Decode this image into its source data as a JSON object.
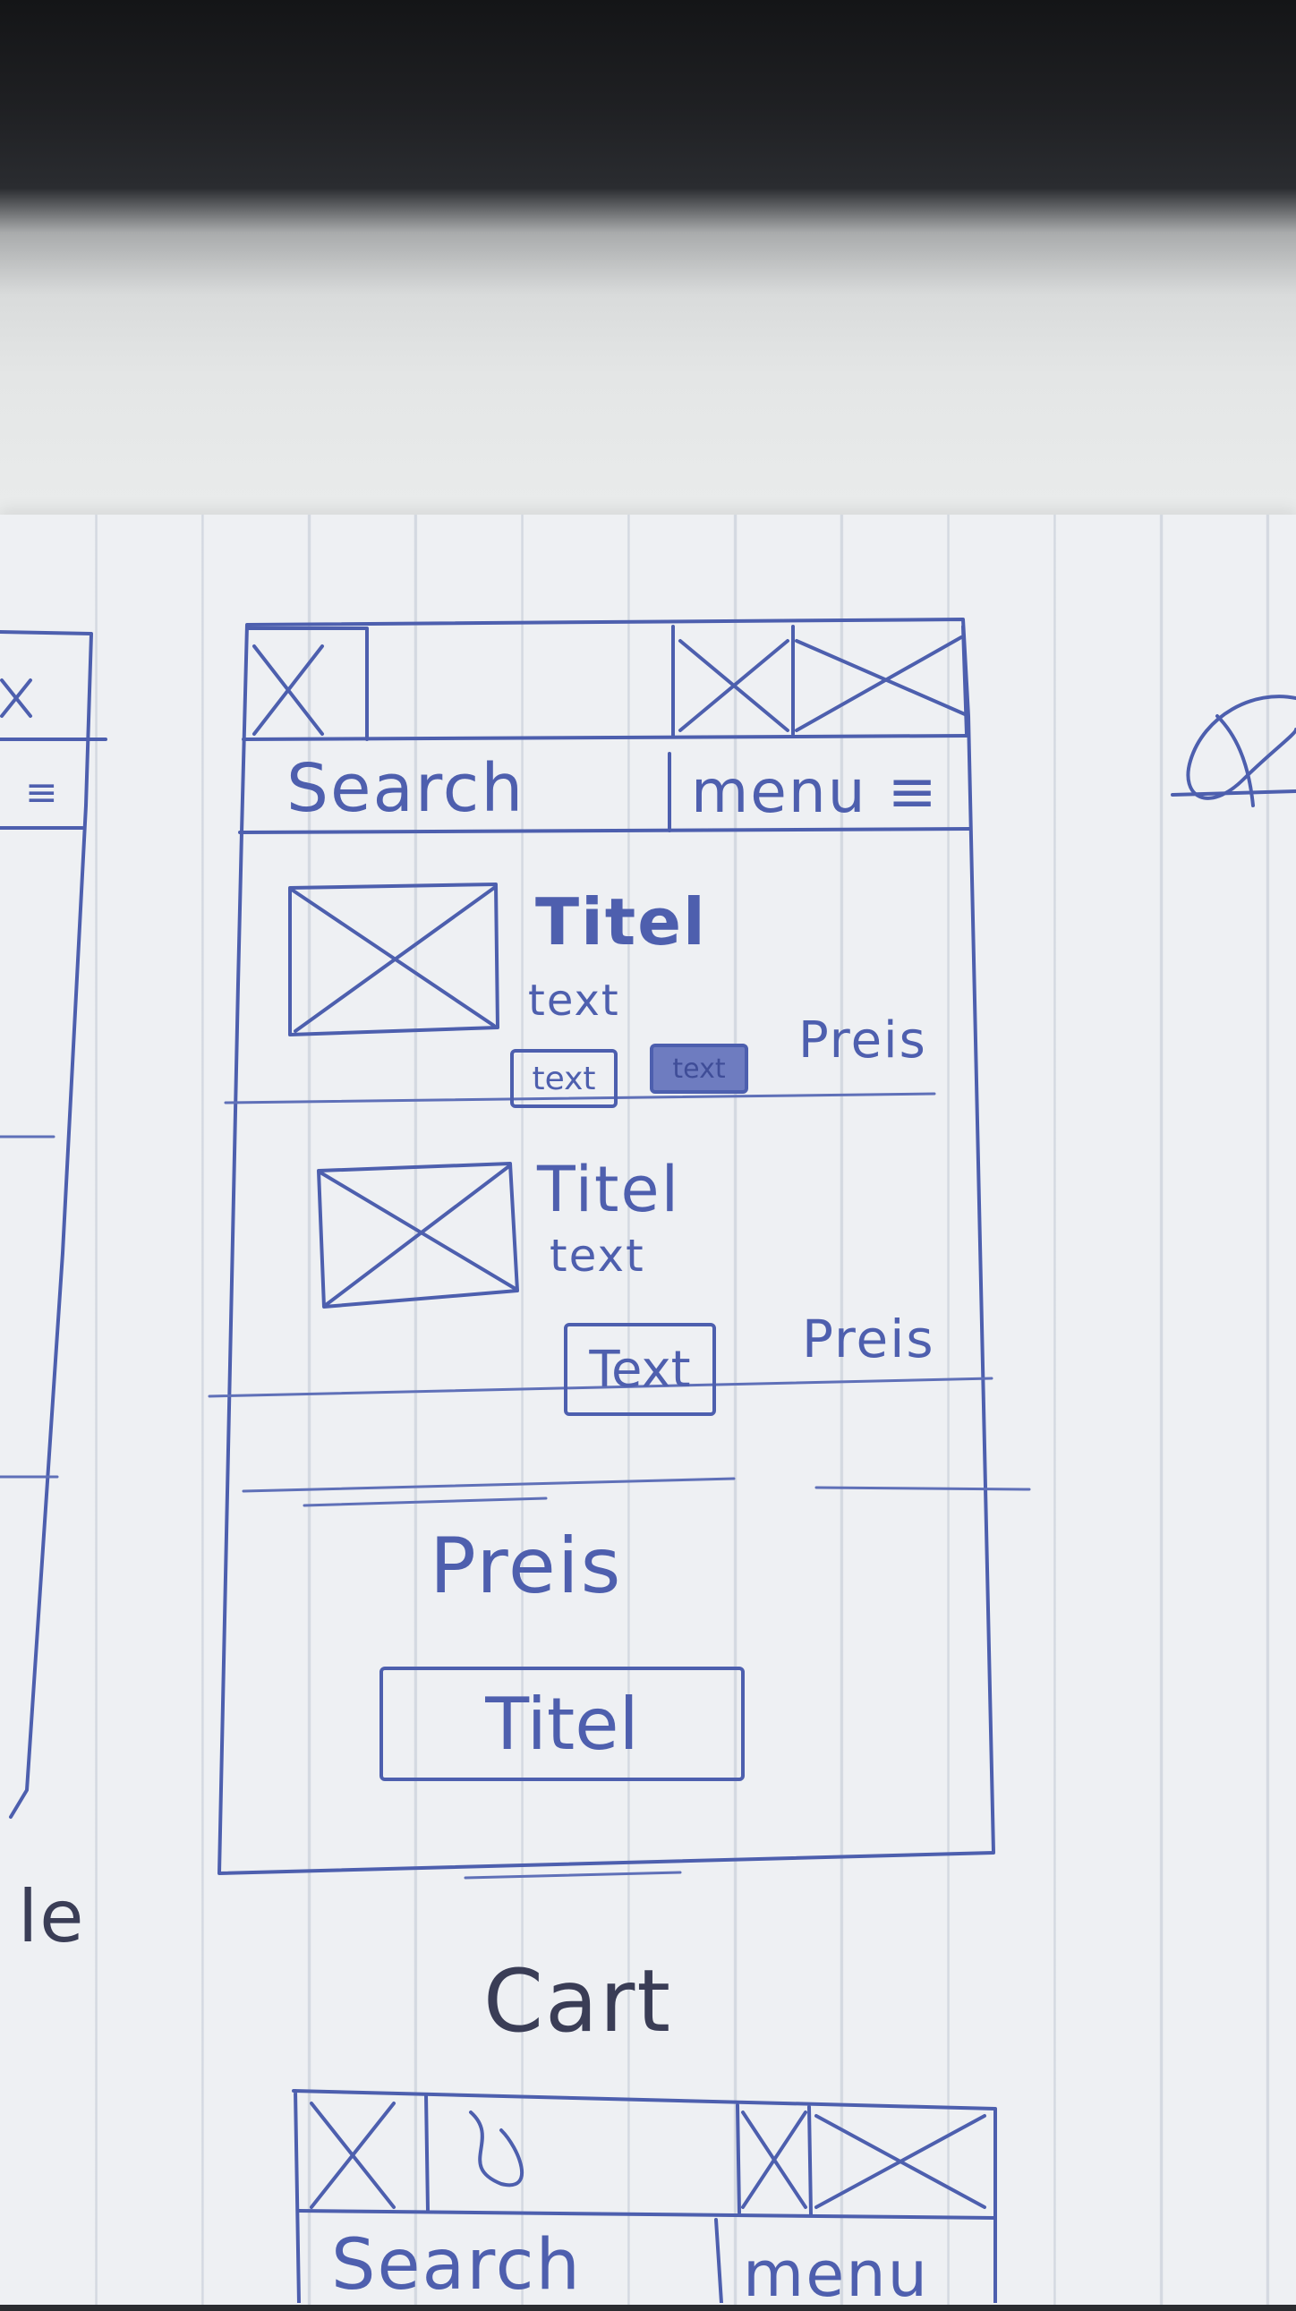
{
  "main_sketch": {
    "header": {
      "search_label": "Search",
      "menu_label": "menu ≡"
    },
    "products": [
      {
        "title": "Titel",
        "description": "text",
        "tags": [
          "text",
          "text"
        ],
        "price": "Preis"
      },
      {
        "title": "Titel",
        "description": "text",
        "tags": [
          "Text"
        ],
        "price": "Preis"
      }
    ],
    "summary": {
      "price": "Preis",
      "button_label": "Titel"
    }
  },
  "page_label": "Cart",
  "left_sketch": {
    "menu_glyph": "≡",
    "partial_text": "le"
  },
  "bottom_sketch": {
    "search_label": "Search",
    "menu_label": "menu"
  },
  "ink_color": "#4d5fae",
  "paper_color": "#eef0f3"
}
